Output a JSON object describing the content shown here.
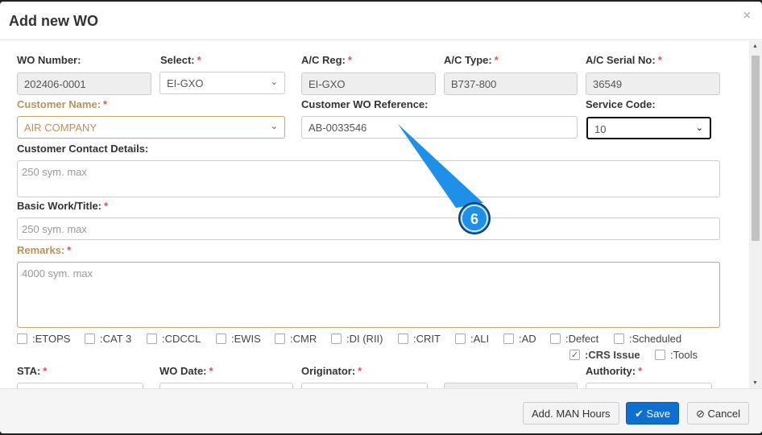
{
  "title": "Add new WO",
  "fields": {
    "wo_number": {
      "label": "WO Number:",
      "value": "202406-0001"
    },
    "select": {
      "label": "Select:",
      "value": "EI-GXO"
    },
    "ac_reg": {
      "label": "A/C Reg:",
      "value": "EI-GXO"
    },
    "ac_type": {
      "label": "A/C Type:",
      "value": "B737-800"
    },
    "ac_serial": {
      "label": "A/C Serial No:",
      "value": "36549"
    },
    "customer_name": {
      "label": "Customer Name:",
      "value": "AIR COMPANY"
    },
    "customer_wo_ref": {
      "label": "Customer WO Reference:",
      "value": "AB-0033546"
    },
    "service_code": {
      "label": "Service Code:",
      "value": "10"
    },
    "contact": {
      "label": "Customer Contact Details:",
      "placeholder": "250 sym. max"
    },
    "basic_work": {
      "label": "Basic Work/Title:",
      "placeholder": "250 sym. max"
    },
    "remarks": {
      "label": "Remarks:",
      "placeholder": "4000 sym. max"
    },
    "sta": {
      "label": "STA:"
    },
    "wo_date": {
      "label": "WO Date:"
    },
    "originator": {
      "label": "Originator:"
    },
    "authority": {
      "label": "Authority:"
    }
  },
  "required_mark": "*",
  "checkboxes": [
    {
      "label": ":ETOPS",
      "checked": false
    },
    {
      "label": ":CAT 3",
      "checked": false
    },
    {
      "label": ":CDCCL",
      "checked": false
    },
    {
      "label": ":EWIS",
      "checked": false
    },
    {
      "label": ":CMR",
      "checked": false
    },
    {
      "label": ":DI (RII)",
      "checked": false
    },
    {
      "label": ":CRIT",
      "checked": false
    },
    {
      "label": ":ALI",
      "checked": false
    },
    {
      "label": ":AD",
      "checked": false
    },
    {
      "label": ":Defect",
      "checked": false
    },
    {
      "label": ":Scheduled",
      "checked": false
    },
    {
      "label": ":CRS Issue",
      "checked": true
    },
    {
      "label": ":Tools",
      "checked": false
    }
  ],
  "footer": {
    "man_hours": "Add. MAN Hours",
    "save": "Save",
    "cancel": "Cancel"
  },
  "callout": {
    "number": "6",
    "color": "#1e90e8"
  }
}
